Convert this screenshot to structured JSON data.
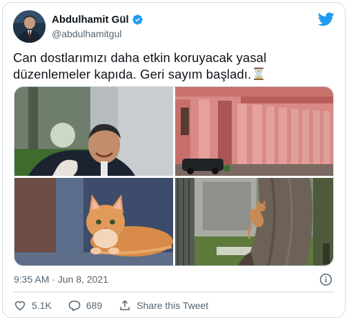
{
  "author": {
    "display_name": "Abdulhamit Gül",
    "handle": "@abdulhamitgul",
    "verified": true
  },
  "tweet": {
    "text": "Can dostlarımızı daha etkin koruyacak yasal düzenlemeler kapıda. Geri sayım başladı.",
    "emoji": "hourglass-icon",
    "timestamp": "9:35 AM · Jun 8, 2021"
  },
  "media": [
    {
      "name": "photo-man-with-cat"
    },
    {
      "name": "photo-ministry-building"
    },
    {
      "name": "photo-orange-kitten"
    },
    {
      "name": "photo-kitten-on-tree"
    }
  ],
  "actions": {
    "likes": "5.1K",
    "replies": "689",
    "share_label": "Share this Tweet"
  },
  "colors": {
    "brand": "#1d9bf0",
    "text": "#0f1419",
    "muted": "#536471",
    "border": "#cfd9de"
  }
}
